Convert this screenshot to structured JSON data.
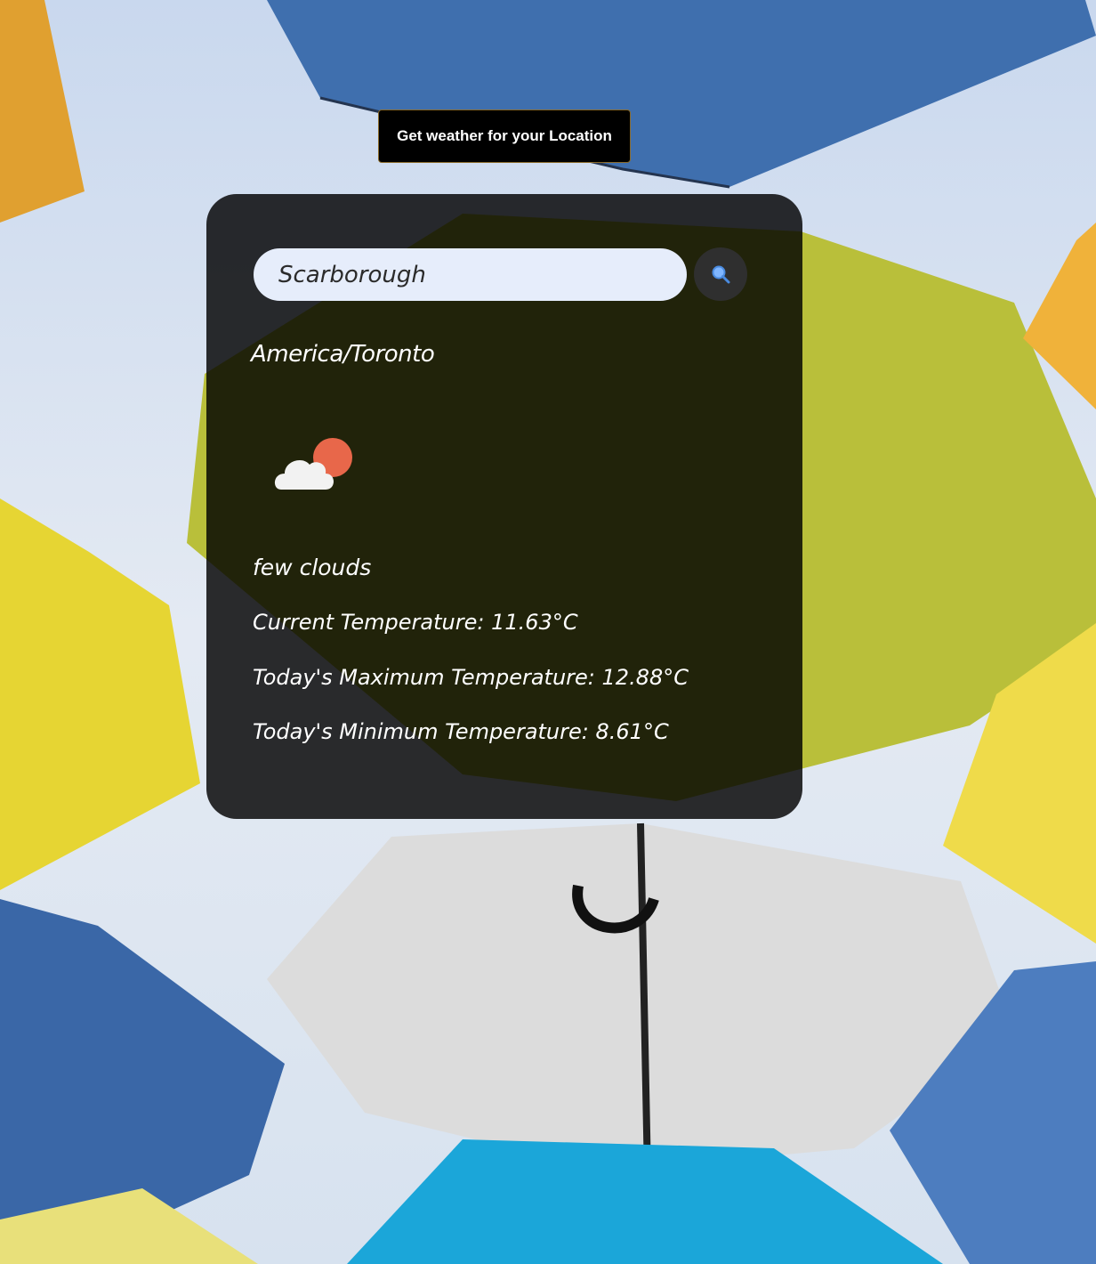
{
  "location_button": {
    "label": "Get weather for your Location"
  },
  "search": {
    "value": "Scarborough",
    "button_icon": "magnifier-icon"
  },
  "weather": {
    "timezone": "America/Toronto",
    "icon": "few-clouds-sun-cloud-icon",
    "description": "few clouds",
    "current": {
      "label": "Current Temperature:",
      "value": "11.63°C"
    },
    "max": {
      "label": "Today's Maximum Temperature:",
      "value": "12.88°C"
    },
    "min": {
      "label": "Today's Minimum Temperature:",
      "value": "8.61°C"
    }
  },
  "colors": {
    "card": "#000000",
    "input_bg": "#e6edfb",
    "sun": "#e8674a",
    "cloud": "#f2f2f2"
  }
}
